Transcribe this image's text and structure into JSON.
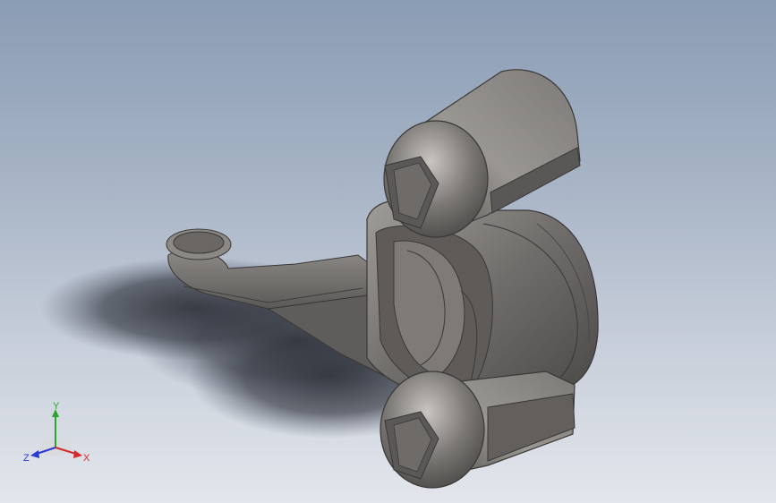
{
  "viewport": {
    "background_top": "#8a9cb4",
    "background_bottom": "#e3e6ec",
    "model_color": "#6f6c6a"
  },
  "triad": {
    "x_label": "X",
    "y_label": "Y",
    "z_label": "Z",
    "x_color": "#d32a2a",
    "y_color": "#2aa52a",
    "z_color": "#2a3ad3"
  }
}
